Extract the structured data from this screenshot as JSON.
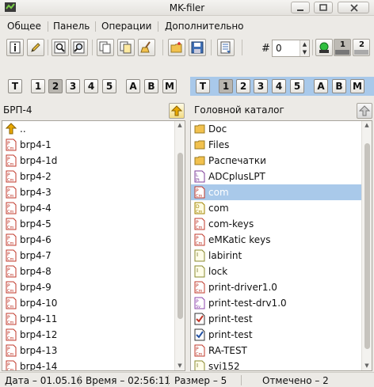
{
  "window": {
    "title": "MK-filer"
  },
  "menu": [
    "Общее",
    "Панель",
    "Операции",
    "Дополнительно"
  ],
  "toolbar": {
    "hash_label": "#",
    "counter_value": "0",
    "mode_labels": [
      "1",
      "2"
    ]
  },
  "left_tabs": [
    "T",
    "1",
    "2",
    "3",
    "4",
    "5",
    "A",
    "B",
    "M"
  ],
  "right_tabs": [
    "T",
    "1",
    "2",
    "3",
    "4",
    "5",
    "A",
    "B",
    "M"
  ],
  "left_panel": {
    "path": "БРП-4",
    "active_tab": "2",
    "items": [
      {
        "name": "..",
        "icon": "up-folder-icon"
      },
      {
        "name": "brp4-1",
        "icon": "com-file-icon"
      },
      {
        "name": "brp4-1d",
        "icon": "com-file-icon"
      },
      {
        "name": "brp4-2",
        "icon": "com-file-icon"
      },
      {
        "name": "brp4-3",
        "icon": "com-file-icon"
      },
      {
        "name": "brp4-4",
        "icon": "com-file-icon"
      },
      {
        "name": "brp4-5",
        "icon": "com-file-icon"
      },
      {
        "name": "brp4-6",
        "icon": "com-file-icon"
      },
      {
        "name": "brp4-7",
        "icon": "com-file-icon"
      },
      {
        "name": "brp4-8",
        "icon": "com-file-icon"
      },
      {
        "name": "brp4-9",
        "icon": "com-file-icon"
      },
      {
        "name": "brp4-10",
        "icon": "com-file-icon"
      },
      {
        "name": "brp4-11",
        "icon": "com-file-icon"
      },
      {
        "name": "brp4-12",
        "icon": "com-file-icon"
      },
      {
        "name": "brp4-13",
        "icon": "com-file-icon"
      },
      {
        "name": "brp4-14",
        "icon": "com-file-icon"
      }
    ]
  },
  "right_panel": {
    "path": "Головной каталог",
    "active_tab": "1",
    "items": [
      {
        "name": "Doc",
        "icon": "folder-icon"
      },
      {
        "name": "Files",
        "icon": "folder-icon",
        "locked": true
      },
      {
        "name": "Распечатки",
        "icon": "folder-icon"
      },
      {
        "name": "ADCplusLPT",
        "icon": "lpt-file-icon"
      },
      {
        "name": "com",
        "icon": "com-file-icon",
        "selected": true
      },
      {
        "name": "com",
        "icon": "data-file-icon"
      },
      {
        "name": "com-keys",
        "icon": "com-file-icon"
      },
      {
        "name": "eMKatic keys",
        "icon": "com-file-icon"
      },
      {
        "name": "labirint",
        "icon": "info-file-icon"
      },
      {
        "name": "lock",
        "icon": "info-file-icon"
      },
      {
        "name": "print-driver1.0",
        "icon": "com-file-icon"
      },
      {
        "name": "print-test-drv1.0",
        "icon": "svc-file-icon"
      },
      {
        "name": "print-test",
        "icon": "checked-file-icon"
      },
      {
        "name": "print-test",
        "icon": "checked-blue-file-icon"
      },
      {
        "name": "RA-TEST",
        "icon": "com-file-icon"
      },
      {
        "name": "svi152",
        "icon": "info-file-icon"
      }
    ]
  },
  "status": {
    "date": "Дата – 01.05.16",
    "time": "Время – 02:56:11",
    "size": "Размер – 5",
    "marked": "Отмечено – 2"
  },
  "colors": {
    "selection": "#a9c9ea",
    "file_icon_red": "#c0392b",
    "folder": "#f2c14e"
  }
}
